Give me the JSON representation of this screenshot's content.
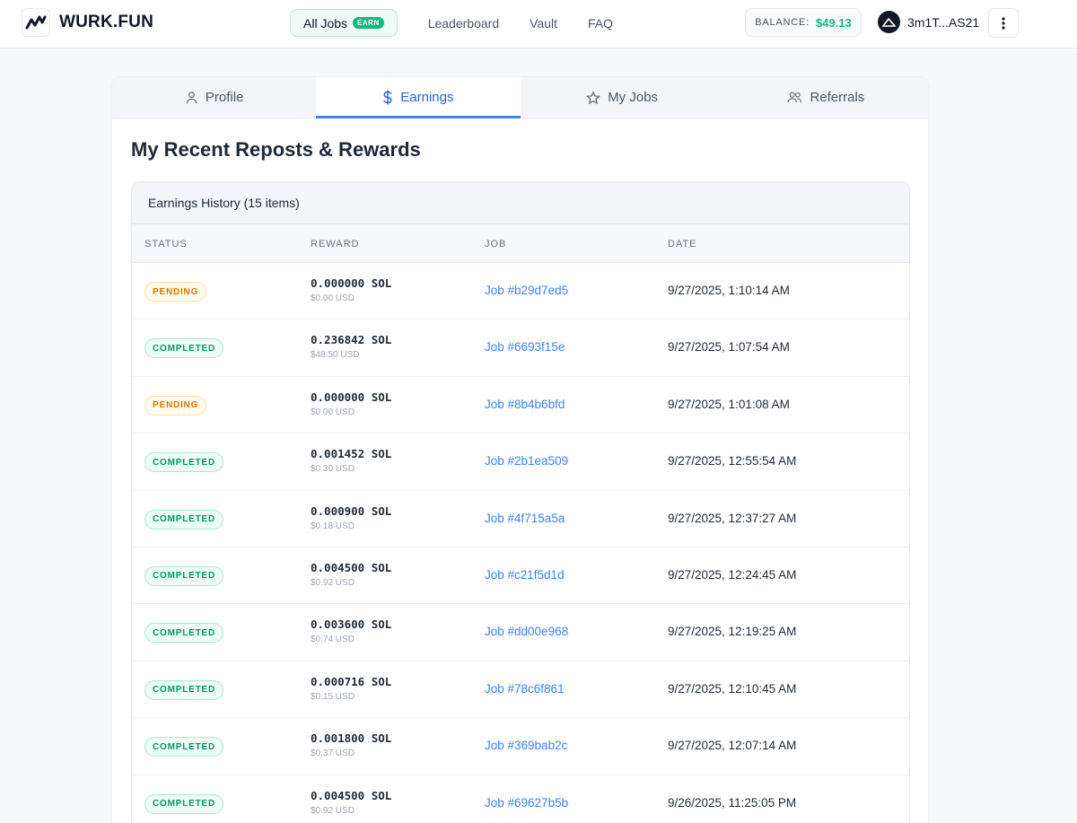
{
  "header": {
    "logo_text": "WURK.FUN",
    "nav": {
      "all_jobs": "All Jobs",
      "earn_badge": "EARN",
      "leaderboard": "Leaderboard",
      "vault": "Vault",
      "faq": "FAQ"
    },
    "balance_label": "BALANCE:",
    "balance_value": "$49.13",
    "wallet_address": "3m1T...AS21"
  },
  "tabs": [
    {
      "label": "Profile",
      "icon": "user-icon",
      "active": false
    },
    {
      "label": "Earnings",
      "icon": "dollar-icon",
      "active": true
    },
    {
      "label": "My Jobs",
      "icon": "star-icon",
      "active": false
    },
    {
      "label": "Referrals",
      "icon": "users-icon",
      "active": false
    }
  ],
  "page_title": "My Recent Reposts & Rewards",
  "history": {
    "title": "Earnings History (15 items)",
    "columns": [
      "STATUS",
      "REWARD",
      "JOB",
      "DATE"
    ],
    "rows": [
      {
        "status": "PENDING",
        "status_type": "pending",
        "sol": "0.000000 SOL",
        "usd": "$0.00 USD",
        "job": "Job #b29d7ed5",
        "date": "9/27/2025, 1:10:14 AM"
      },
      {
        "status": "COMPLETED",
        "status_type": "completed",
        "sol": "0.236842 SOL",
        "usd": "$48.50 USD",
        "job": "Job #6693f15e",
        "date": "9/27/2025, 1:07:54 AM"
      },
      {
        "status": "PENDING",
        "status_type": "pending",
        "sol": "0.000000 SOL",
        "usd": "$0.00 USD",
        "job": "Job #8b4b6bfd",
        "date": "9/27/2025, 1:01:08 AM"
      },
      {
        "status": "COMPLETED",
        "status_type": "completed",
        "sol": "0.001452 SOL",
        "usd": "$0.30 USD",
        "job": "Job #2b1ea509",
        "date": "9/27/2025, 12:55:54 AM"
      },
      {
        "status": "COMPLETED",
        "status_type": "completed",
        "sol": "0.000900 SOL",
        "usd": "$0.18 USD",
        "job": "Job #4f715a5a",
        "date": "9/27/2025, 12:37:27 AM"
      },
      {
        "status": "COMPLETED",
        "status_type": "completed",
        "sol": "0.004500 SOL",
        "usd": "$0.92 USD",
        "job": "Job #c21f5d1d",
        "date": "9/27/2025, 12:24:45 AM"
      },
      {
        "status": "COMPLETED",
        "status_type": "completed",
        "sol": "0.003600 SOL",
        "usd": "$0.74 USD",
        "job": "Job #dd00e968",
        "date": "9/27/2025, 12:19:25 AM"
      },
      {
        "status": "COMPLETED",
        "status_type": "completed",
        "sol": "0.000716 SOL",
        "usd": "$0.15 USD",
        "job": "Job #78c6f861",
        "date": "9/27/2025, 12:10:45 AM"
      },
      {
        "status": "COMPLETED",
        "status_type": "completed",
        "sol": "0.001800 SOL",
        "usd": "$0.37 USD",
        "job": "Job #369bab2c",
        "date": "9/27/2025, 12:07:14 AM"
      },
      {
        "status": "COMPLETED",
        "status_type": "completed",
        "sol": "0.004500 SOL",
        "usd": "$0.92 USD",
        "job": "Job #69627b5b",
        "date": "9/26/2025, 11:25:05 PM"
      }
    ]
  },
  "colors": {
    "accent_green": "#10b981",
    "accent_blue": "#3b82f6",
    "pending": "#d97706",
    "completed": "#059669"
  }
}
